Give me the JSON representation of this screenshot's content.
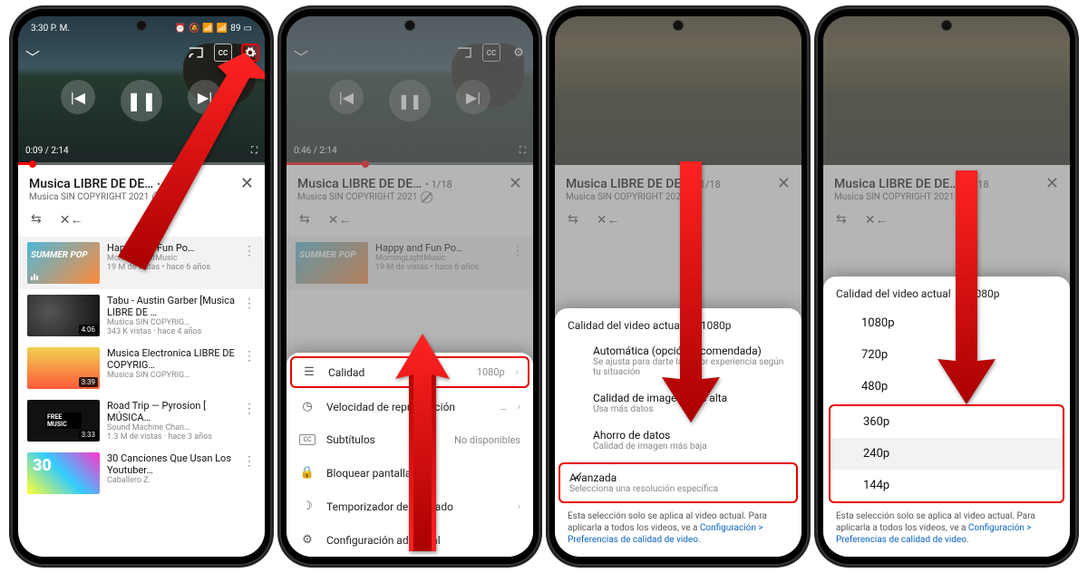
{
  "status": {
    "time": "3:30 P. M.",
    "battery": "89"
  },
  "video": {
    "elapsed": "0:09",
    "total": "2:14",
    "elapsed2": "0:46",
    "total2": "2:14"
  },
  "header": {
    "title": "Musica LIBRE DE DE…",
    "count": "• 1/18",
    "subtitle": "Musica SIN COPYRIGHT 2021"
  },
  "playlist": [
    {
      "title": "Happy and Fun Po…",
      "channel": "MorningLightMusic",
      "meta": "19 M de vistas • hace 6 años",
      "dur": ""
    },
    {
      "title": "Tabu - Austin Garber [Musica LIBRE DE …",
      "channel": "Musica SIN COPYRIG…",
      "meta": "343 K vistas · hace 4 años",
      "dur": "4:06"
    },
    {
      "title": "Musica Electronica LIBRE DE COPYRIG…",
      "channel": "Musica SIN COPYRIG…",
      "meta": "",
      "dur": "3:39"
    },
    {
      "title": "Road Trip — Pyrosion [ MÚSICA…",
      "channel": "Sound Machine Chan…",
      "meta": "1.3 M de vistas · hace 3 años",
      "dur": "3:33"
    },
    {
      "title": "30 Canciones Que Usan Los Youtuber…",
      "channel": "Caballero Z.",
      "meta": "",
      "dur": ""
    }
  ],
  "settings": {
    "quality": {
      "label": "Calidad",
      "value": "1080p"
    },
    "speed": {
      "label": "Velocidad de reproducción",
      "value": "…"
    },
    "subs": {
      "label": "Subtítulos",
      "value": "No disponibles"
    },
    "lock": {
      "label": "Bloquear pantalla"
    },
    "sleep": {
      "label": "Temporizador de apagado",
      "value": ""
    },
    "more": {
      "label": "Configuración adicional"
    }
  },
  "quality_sheet": {
    "head_label": "Calidad del video actual",
    "head_value": "1080p",
    "auto": {
      "t": "Automática (opción recomendada)",
      "d": "Se ajusta para darte la mejor experiencia según tu situación"
    },
    "high": {
      "t": "Calidad de imagen más alta",
      "d": "Usa más datos"
    },
    "saver": {
      "t": "Ahorro de datos",
      "d": "Calidad de imagen más baja"
    },
    "adv": {
      "t": "Avanzada",
      "d": "Selecciona una resolución específica"
    },
    "note1": "Esta selección solo se aplica al video actual. Para aplicarla a todos los videos, ve a ",
    "note_link": "Configuración > Preferencias de calidad de video"
  },
  "resolutions": [
    "1080p",
    "720p",
    "480p",
    "360p",
    "240p",
    "144p"
  ]
}
